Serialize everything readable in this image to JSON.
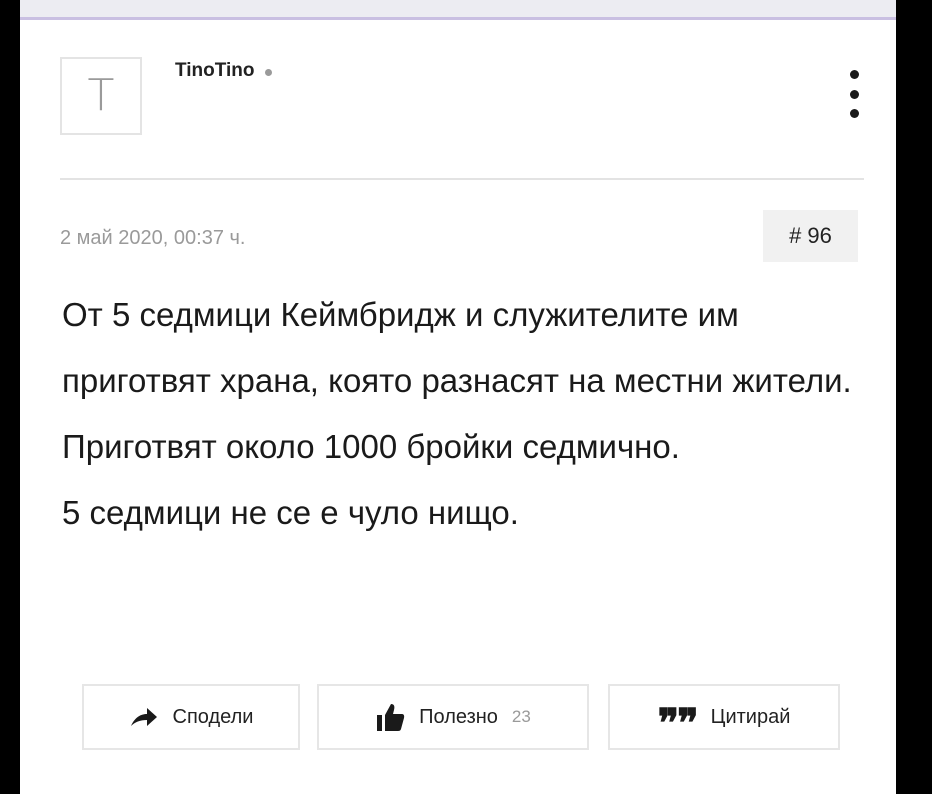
{
  "post": {
    "avatar_letter": "T",
    "username": "TinoTino",
    "date": "2 май 2020, 00:37 ч.",
    "number": "# 96",
    "paragraphs": [
      "От 5 седмици Кеймбридж и служителите им приготвят храна, която разнасят на местни жители. Приготвят около 1000 бройки седмично.",
      "5 седмици не се е чуло нищо."
    ]
  },
  "actions": {
    "share_label": "Сподели",
    "useful_label": "Полезно",
    "useful_count": "23",
    "quote_label": "Цитирай"
  },
  "icons": {
    "share": "share-arrow-icon",
    "useful": "thumbs-up-icon",
    "quote": "quote-icon",
    "menu": "kebab-menu-icon",
    "online": "online-status-icon"
  },
  "colors": {
    "text": "#1a1a1a",
    "muted": "#9a9a9a",
    "border": "#e6e6e6",
    "accent_strip": "#c9bfe2"
  }
}
